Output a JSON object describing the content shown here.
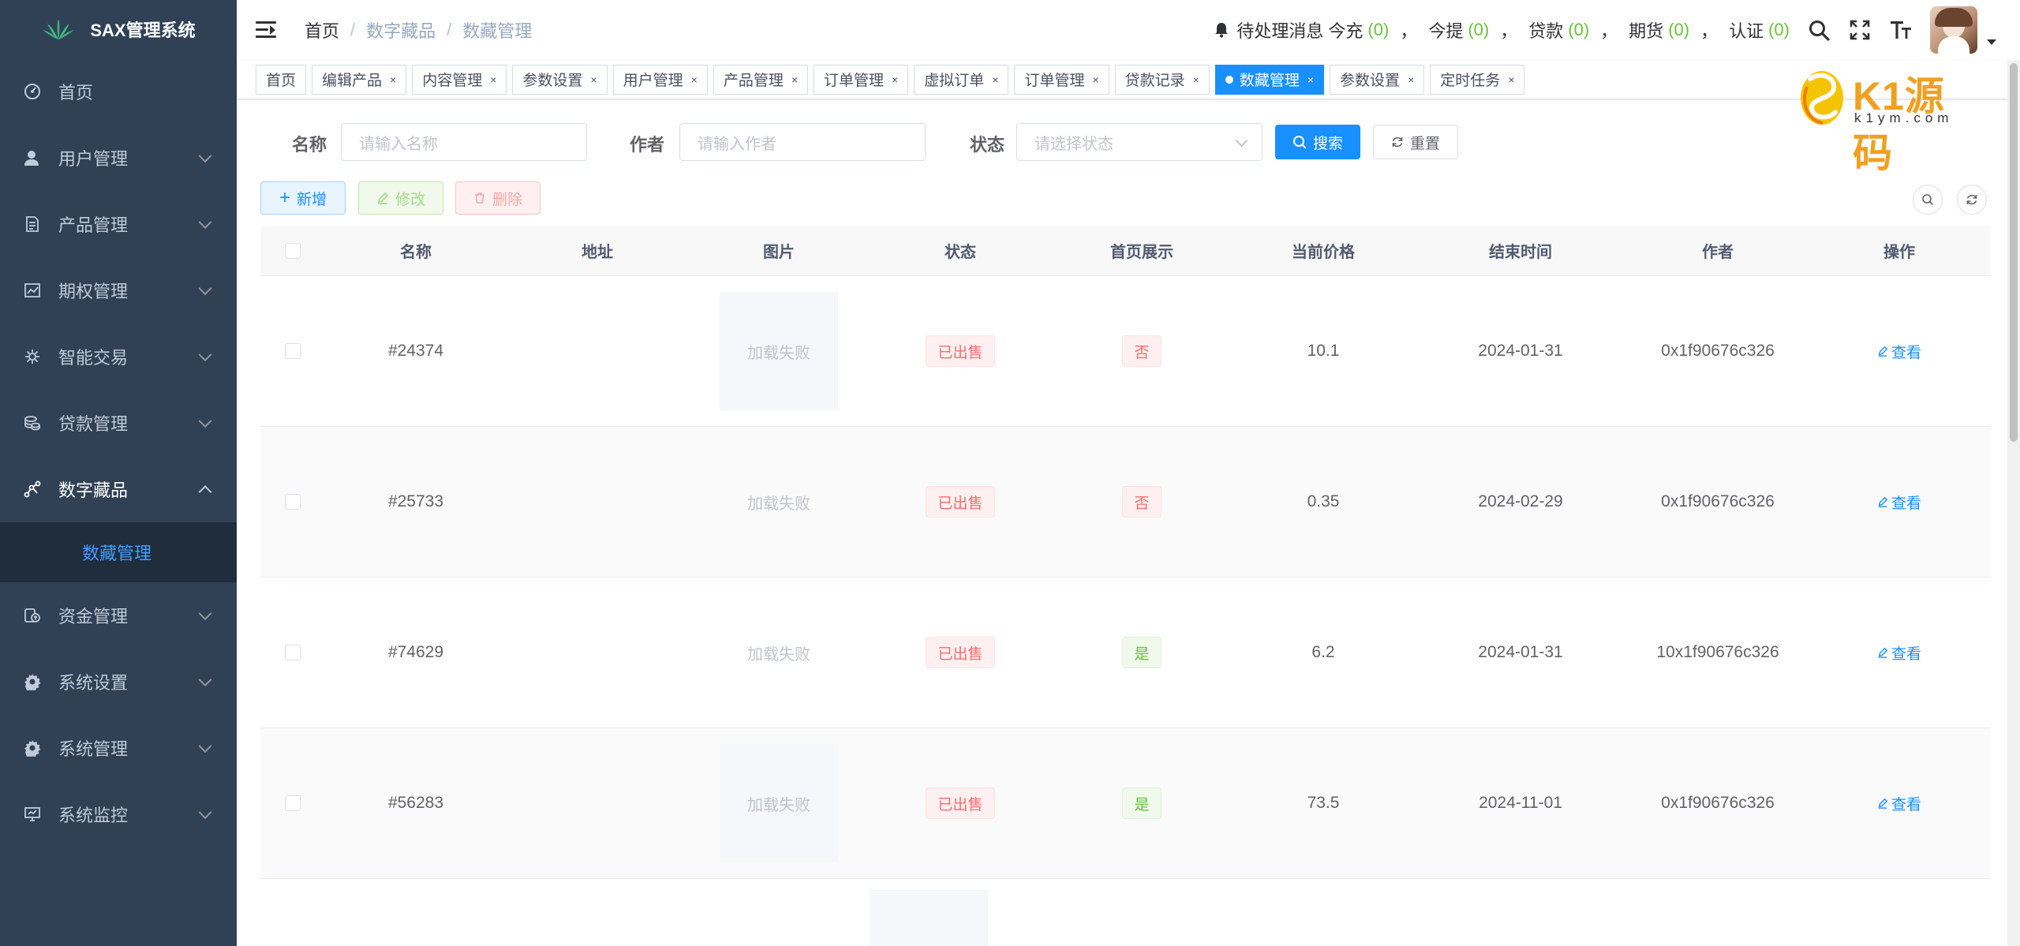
{
  "app": {
    "title": "SAX管理系统"
  },
  "sidebar": {
    "items": [
      {
        "label": "首页",
        "icon": "dashboard-icon",
        "has_children": false
      },
      {
        "label": "用户管理",
        "icon": "user-icon",
        "has_children": true
      },
      {
        "label": "产品管理",
        "icon": "document-icon",
        "has_children": true
      },
      {
        "label": "期权管理",
        "icon": "chart-icon",
        "has_children": true
      },
      {
        "label": "智能交易",
        "icon": "bug-icon",
        "has_children": true
      },
      {
        "label": "贷款管理",
        "icon": "money-icon",
        "has_children": true
      },
      {
        "label": "数字藏品",
        "icon": "nodes-icon",
        "has_children": true,
        "open": true,
        "children": [
          {
            "label": "数藏管理"
          }
        ]
      },
      {
        "label": "资金管理",
        "icon": "wallet-icon",
        "has_children": true
      },
      {
        "label": "系统设置",
        "icon": "gear-icon",
        "has_children": true
      },
      {
        "label": "系统管理",
        "icon": "gear-icon",
        "has_children": true
      },
      {
        "label": "系统监控",
        "icon": "monitor-icon",
        "has_children": true
      }
    ]
  },
  "header": {
    "breadcrumb": [
      "首页",
      "数字藏品",
      "数藏管理"
    ],
    "notice": {
      "prefix": "待处理消息",
      "items": [
        {
          "label": "今充",
          "count": "(0)"
        },
        {
          "label": "今提",
          "count": "(0)"
        },
        {
          "label": "贷款",
          "count": "(0)"
        },
        {
          "label": "期货",
          "count": "(0)"
        },
        {
          "label": "认证",
          "count": "(0)"
        }
      ],
      "separator": "，"
    }
  },
  "tags": [
    {
      "label": "首页",
      "closable": false
    },
    {
      "label": "编辑产品",
      "closable": true
    },
    {
      "label": "内容管理",
      "closable": true
    },
    {
      "label": "参数设置",
      "closable": true
    },
    {
      "label": "用户管理",
      "closable": true
    },
    {
      "label": "产品管理",
      "closable": true
    },
    {
      "label": "订单管理",
      "closable": true
    },
    {
      "label": "虚拟订单",
      "closable": true
    },
    {
      "label": "订单管理",
      "closable": true
    },
    {
      "label": "贷款记录",
      "closable": true
    },
    {
      "label": "数藏管理",
      "closable": true,
      "active": true
    },
    {
      "label": "参数设置",
      "closable": true
    },
    {
      "label": "定时任务",
      "closable": true
    }
  ],
  "close_glyph": "×",
  "watermark": {
    "text": "K1源码",
    "sub": "k1ym.com"
  },
  "search": {
    "name_label": "名称",
    "name_placeholder": "请输入名称",
    "author_label": "作者",
    "author_placeholder": "请输入作者",
    "status_label": "状态",
    "status_placeholder": "请选择状态",
    "search_button": "搜索",
    "reset_button": "重置"
  },
  "toolbar": {
    "add_label": "新增",
    "edit_label": "修改",
    "delete_label": "删除"
  },
  "table": {
    "columns": [
      "名称",
      "地址",
      "图片",
      "状态",
      "首页展示",
      "当前价格",
      "结束时间",
      "作者",
      "操作"
    ],
    "rows": [
      {
        "name": "#24374",
        "address": "",
        "image": "加载失败",
        "status": "已出售",
        "home": "否",
        "home_yes": false,
        "price": "10.1",
        "end_time": "2024-01-31",
        "author": "0x1f90676c326",
        "action": "查看"
      },
      {
        "name": "#25733",
        "address": "",
        "image": "加载失败",
        "status": "已出售",
        "home": "否",
        "home_yes": false,
        "price": "0.35",
        "end_time": "2024-02-29",
        "author": "0x1f90676c326",
        "action": "查看"
      },
      {
        "name": "#74629",
        "address": "",
        "image": "加载失败",
        "status": "已出售",
        "home": "是",
        "home_yes": true,
        "price": "6.2",
        "end_time": "2024-01-31",
        "author": "10x1f90676c326",
        "action": "查看"
      },
      {
        "name": "#56283",
        "address": "",
        "image": "加载失败",
        "status": "已出售",
        "home": "是",
        "home_yes": true,
        "price": "73.5",
        "end_time": "2024-11-01",
        "author": "0x1f90676c326",
        "action": "查看"
      }
    ]
  }
}
